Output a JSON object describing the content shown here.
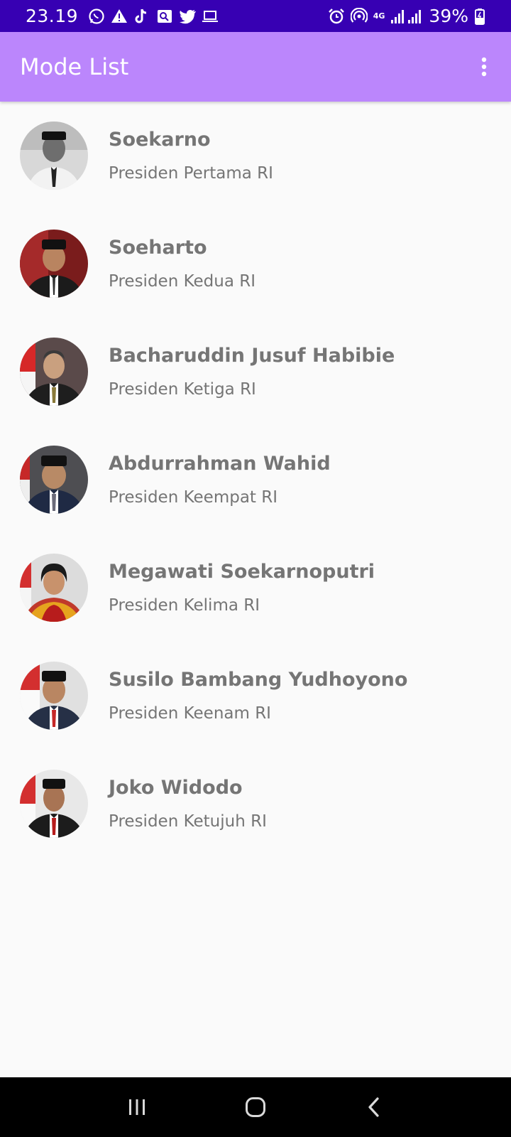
{
  "status_bar": {
    "time": "23.19",
    "battery_percent": "39%",
    "network_type": "4G",
    "left_icons": [
      "whatsapp-icon",
      "warning-icon",
      "tiktok-icon",
      "gallery-icon",
      "twitter-icon",
      "laptop-icon"
    ],
    "right_icons": [
      "alarm-icon",
      "hotspot-icon",
      "signal-icon",
      "battery-icon"
    ]
  },
  "app_bar": {
    "title": "Mode List",
    "overflow_icon": "more-vert-icon"
  },
  "presidents": [
    {
      "name": "Soekarno",
      "description": "Presiden Pertama RI"
    },
    {
      "name": "Soeharto",
      "description": "Presiden Kedua RI"
    },
    {
      "name": "Bacharuddin Jusuf Habibie",
      "description": "Presiden Ketiga RI"
    },
    {
      "name": "Abdurrahman Wahid",
      "description": "Presiden Keempat RI"
    },
    {
      "name": "Megawati Soekarnoputri",
      "description": "Presiden Kelima RI"
    },
    {
      "name": "Susilo Bambang Yudhoyono",
      "description": "Presiden Keenam RI"
    },
    {
      "name": "Joko Widodo",
      "description": "Presiden Ketujuh RI"
    }
  ],
  "nav_bar": {
    "icons": [
      "recent-apps-icon",
      "home-icon",
      "back-icon"
    ]
  },
  "colors": {
    "status_bar": "#3700b3",
    "app_bar": "#bb86fc",
    "background": "#fafafa",
    "text": "#757575"
  }
}
